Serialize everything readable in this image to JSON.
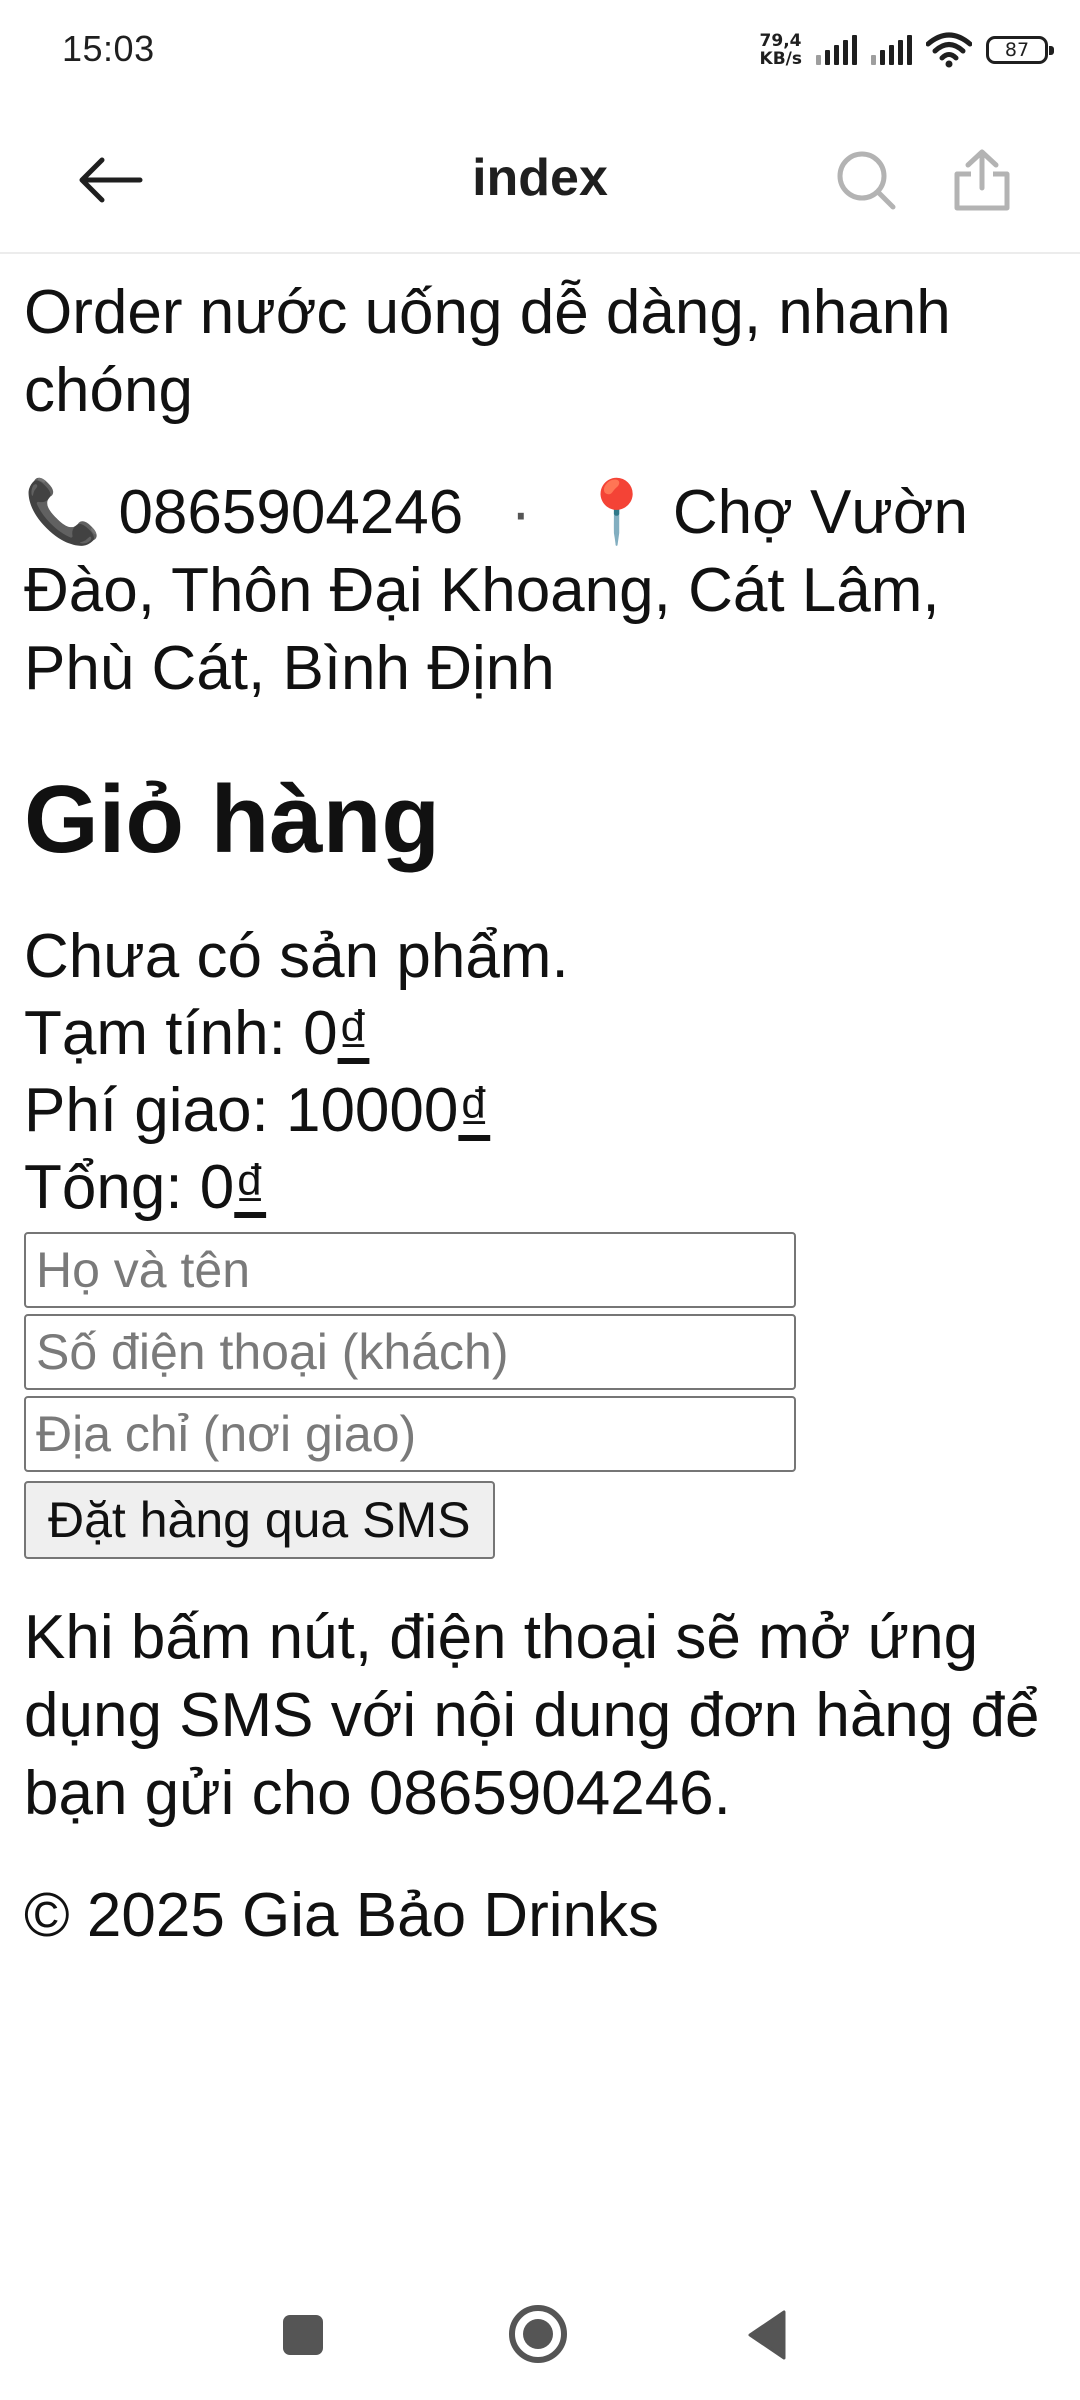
{
  "status_bar": {
    "time": "15:03",
    "net_speed_value": "79,4",
    "net_speed_unit": "KB/s",
    "battery": "87",
    "icons": [
      "signal-icon",
      "signal-icon",
      "wifi-icon",
      "battery-icon"
    ]
  },
  "app_bar": {
    "title": "index",
    "back_icon": "arrow-left-icon",
    "search_icon": "search-icon",
    "share_icon": "share-icon"
  },
  "page": {
    "tagline": "Order nước uống dễ dàng, nhanh chóng",
    "contact": {
      "phone_emoji": "📞",
      "phone": "0865904246",
      "separator": "·",
      "pin_emoji": "📍",
      "address": "Chợ Vườn Đào, Thôn Đại Khoang, Cát Lâm, Phù Cát, Bình Định"
    },
    "cart": {
      "title": "Giỏ hàng",
      "empty": "Chưa có sản phẩm.",
      "subtotal_label": "Tạm tính: ",
      "subtotal_value": "0",
      "shipping_label": "Phí giao: ",
      "shipping_value": "10000",
      "total_label": "Tổng: ",
      "total_value": "0",
      "currency": "₫"
    },
    "form": {
      "name_placeholder": "Họ và tên",
      "phone_placeholder": "Số điện thoại (khách)",
      "address_placeholder": "Địa chỉ (nơi giao)",
      "submit_label": "Đặt hàng qua SMS"
    },
    "note": "Khi bấm nút, điện thoại sẽ mở ứng dụng SMS với nội dung đơn hàng để bạn gửi cho 0865904246.",
    "footer": "© 2025 Gia Bảo Drinks"
  },
  "nav_bar": {
    "icons": [
      "recents-icon",
      "home-icon",
      "back-icon"
    ]
  }
}
